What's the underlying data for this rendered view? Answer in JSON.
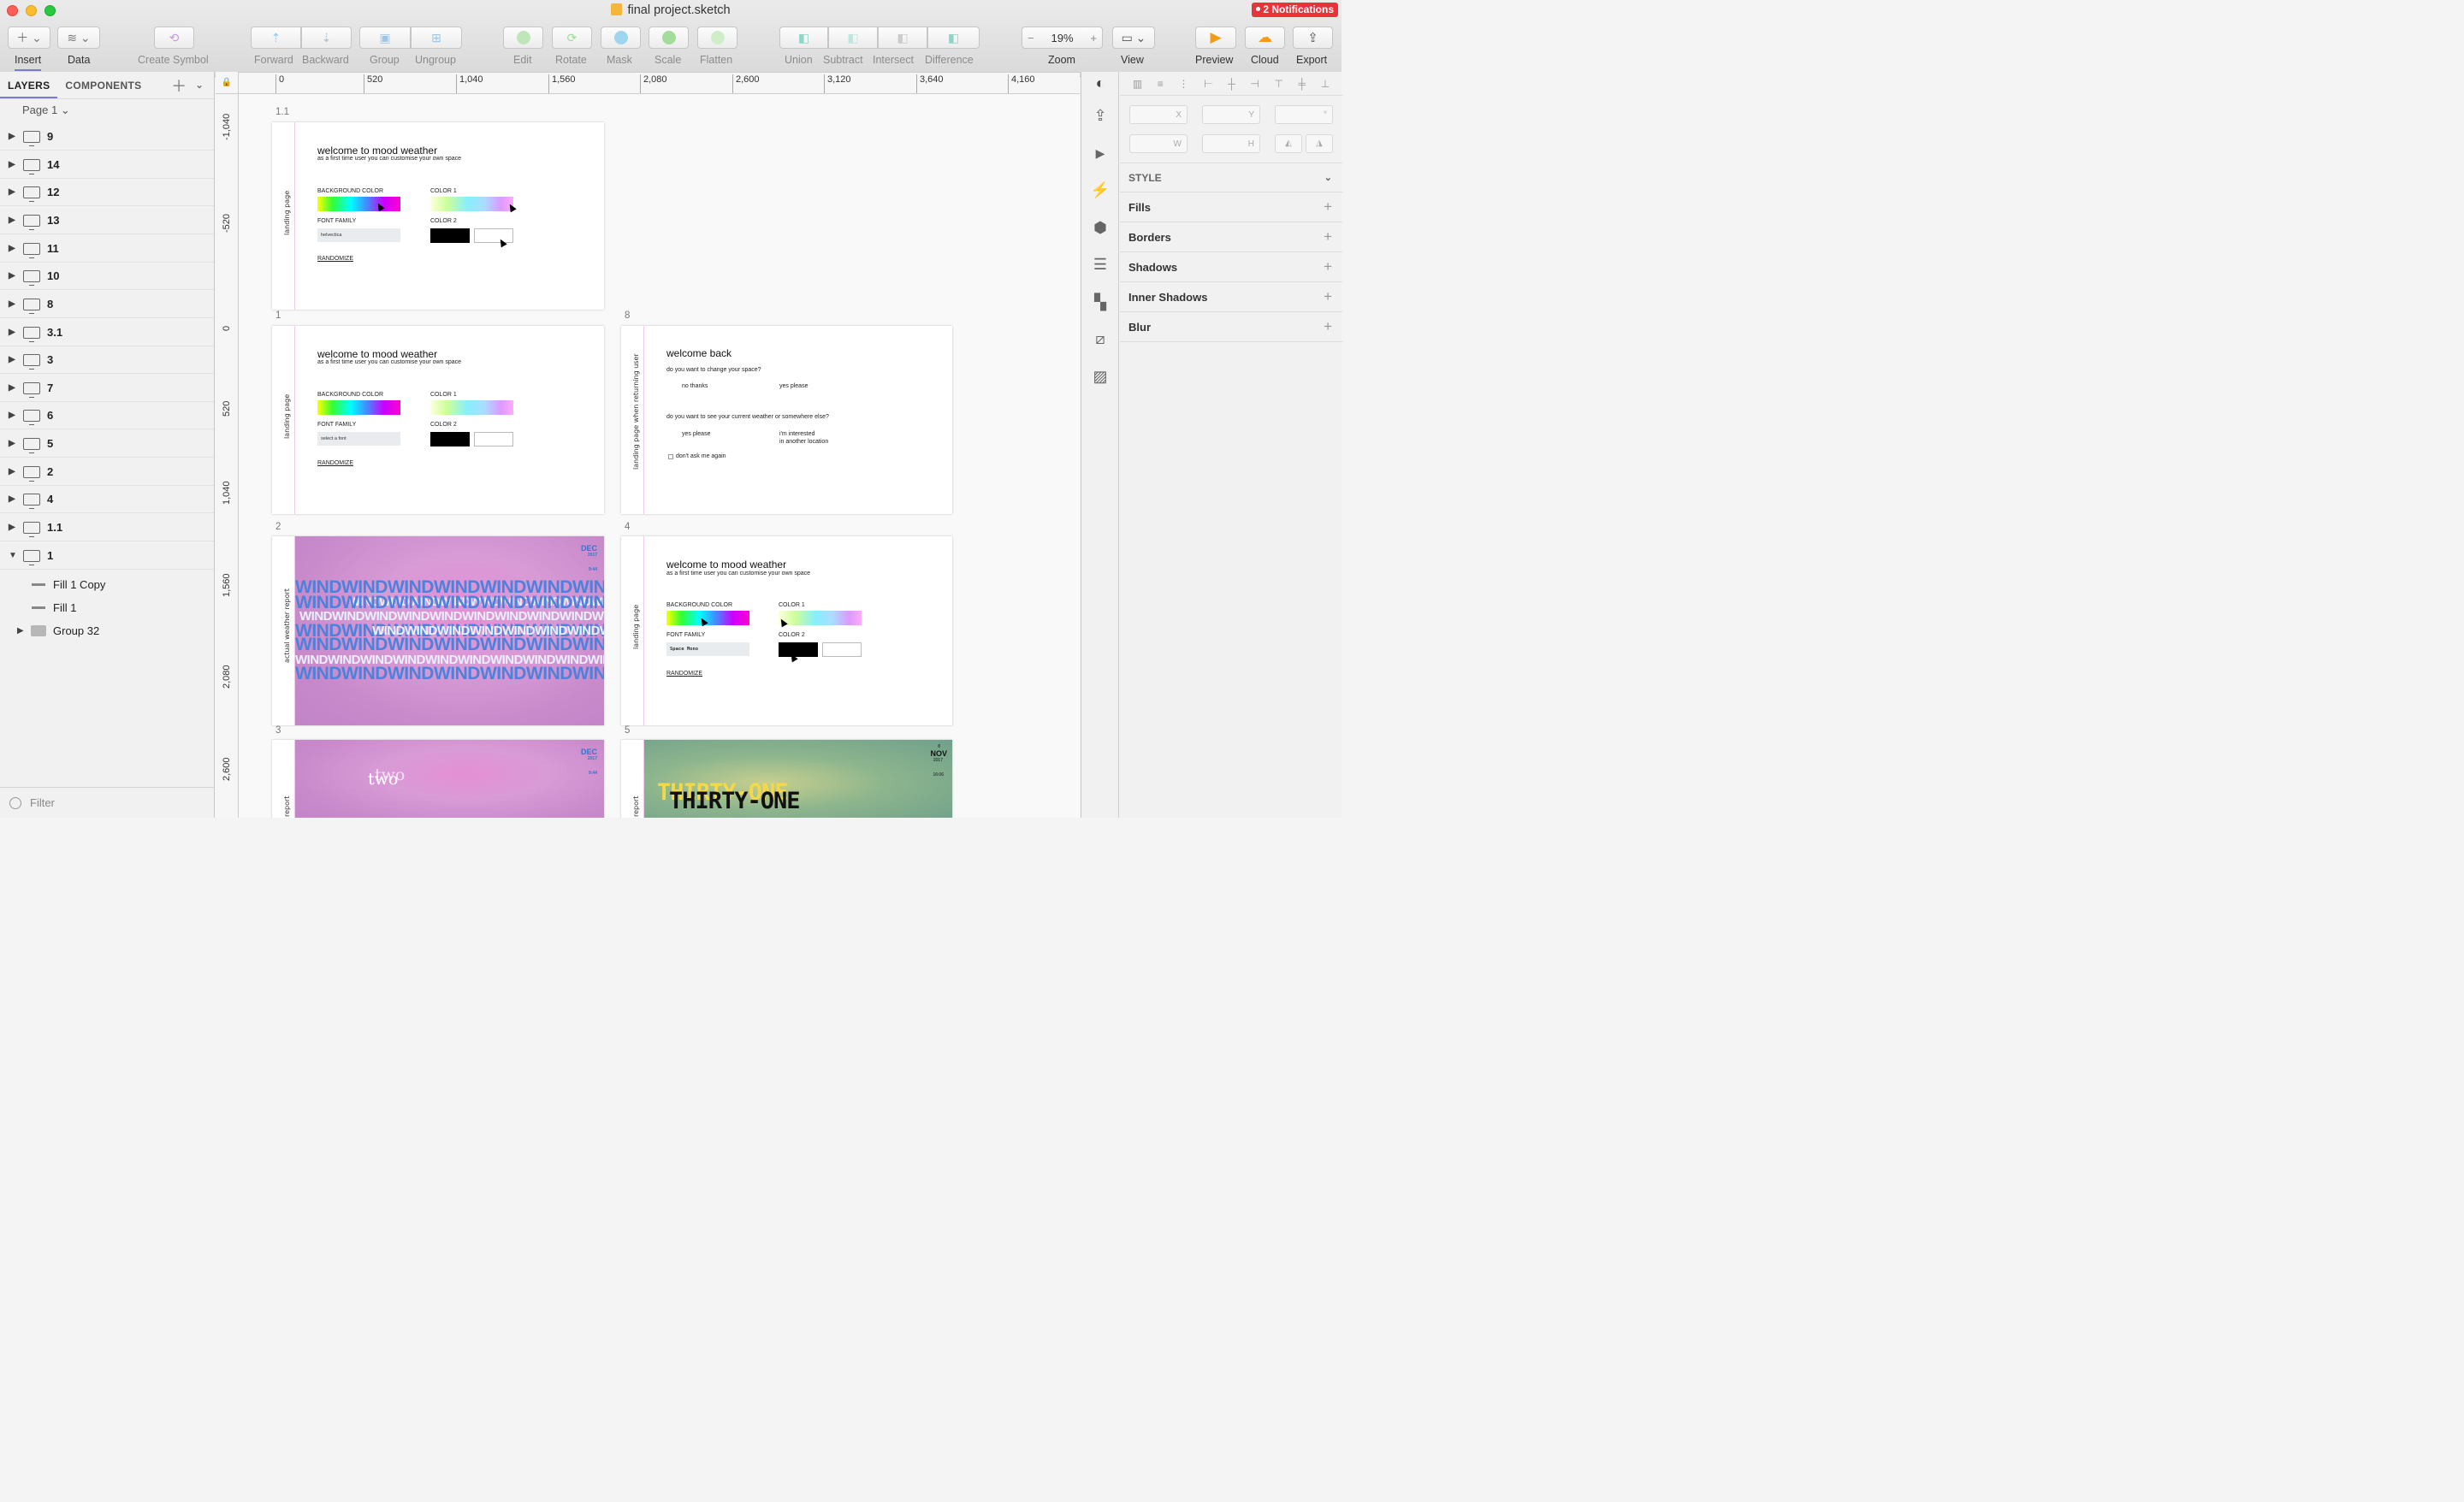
{
  "window": {
    "title": "final project.sketch",
    "notifications": "2 Notifications"
  },
  "toolbar": {
    "insert": "Insert",
    "data": "Data",
    "create_symbol": "Create Symbol",
    "forward": "Forward",
    "backward": "Backward",
    "group": "Group",
    "ungroup": "Ungroup",
    "edit": "Edit",
    "rotate": "Rotate",
    "mask": "Mask",
    "scale": "Scale",
    "flatten": "Flatten",
    "union": "Union",
    "subtract": "Subtract",
    "intersect": "Intersect",
    "difference": "Difference",
    "zoom_label": "Zoom",
    "zoom_value": "19%",
    "view": "View",
    "preview": "Preview",
    "cloud": "Cloud",
    "export": "Export",
    "zoom_out": "−",
    "zoom_in": "+"
  },
  "ruler": {
    "h_ticks": [
      "0",
      "520",
      "1,040",
      "1,560",
      "2,080",
      "2,600",
      "3,120",
      "3,640",
      "4,160"
    ],
    "v_ticks": [
      "-1,040",
      "-520",
      "0",
      "520",
      "1,040",
      "1,560",
      "2,080",
      "2,600"
    ]
  },
  "layers_panel": {
    "tab_layers": "LAYERS",
    "tab_components": "COMPONENTS",
    "page": "Page 1",
    "layers": [
      "9",
      "14",
      "12",
      "13",
      "11",
      "10",
      "8",
      "3.1",
      "3",
      "7",
      "6",
      "5",
      "2",
      "4",
      "1.1",
      "1"
    ],
    "children": [
      "Fill 1 Copy",
      "Fill 1",
      "Group 32"
    ],
    "filter_placeholder": "Filter"
  },
  "artboards": {
    "ab11": {
      "label": "1.1",
      "side": "landing page",
      "title": "welcome to mood weather",
      "subtitle": "as a first time user you can customise your own space",
      "bg_color": "BACKGROUND COLOR",
      "color1": "COLOR 1",
      "font_family": "FONT FAMILY",
      "color2": "COLOR 2",
      "font_value": "helvectica",
      "randomize": "RANDOMIZE"
    },
    "ab1": {
      "label": "1",
      "side": "landing page",
      "title": "welcome to mood weather",
      "subtitle": "as a first time user you can customise your own space",
      "bg_color": "BACKGROUND COLOR",
      "color1": "COLOR 1",
      "font_family": "FONT FAMILY",
      "color2": "COLOR 2",
      "font_value": "select a font",
      "randomize": "RANDOMIZE"
    },
    "ab8": {
      "label": "8",
      "side": "landing page when returning user",
      "title": "welcome back",
      "q1": "do you want to change your space?",
      "no": "no thanks",
      "yes": "yes please",
      "q2": "do you want to see your current weather or somewhere else?",
      "yes2": "yes please",
      "interested": "i'm interested",
      "location": "in another location",
      "dont": "don't ask me again"
    },
    "ab2": {
      "label": "2",
      "side": "actual weather report",
      "word": "WINDWINDWINDWINDWINDWINDWINDWINDWINDWINDWIND",
      "month": "DEC",
      "year": "2017",
      "time": "9:44"
    },
    "ab4": {
      "label": "4",
      "side": "landing page",
      "title": "welcome to mood weather",
      "subtitle": "as a first time user you can customise your own space",
      "bg_color": "BACKGROUND COLOR",
      "color1": "COLOR 1",
      "font_family": "FONT FAMILY",
      "color2": "COLOR 2",
      "font_value": "Space Mono",
      "randomize": "RANDOMIZE"
    },
    "ab3": {
      "label": "3",
      "side": "report",
      "word": "two",
      "month": "DEC",
      "year": "2017",
      "time": "9:44"
    },
    "ab5": {
      "label": "5",
      "side": "report",
      "word": "THIRTY-ONE",
      "word_shadow": "THIRTY-ONE",
      "day": "8",
      "month": "NOV",
      "year": "2017",
      "time": "16:06"
    }
  },
  "inspector": {
    "x": "X",
    "y": "Y",
    "deg": "°",
    "w": "W",
    "h": "H",
    "style": "STYLE",
    "fills": "Fills",
    "borders": "Borders",
    "shadows": "Shadows",
    "inner_shadows": "Inner Shadows",
    "blur": "Blur",
    "add": "+"
  },
  "colors": {
    "accent": "#7b7bd6",
    "notification": "#e8333a",
    "wind_blue": "#4a82dc",
    "sidebar_line": "#f1c9ec"
  }
}
